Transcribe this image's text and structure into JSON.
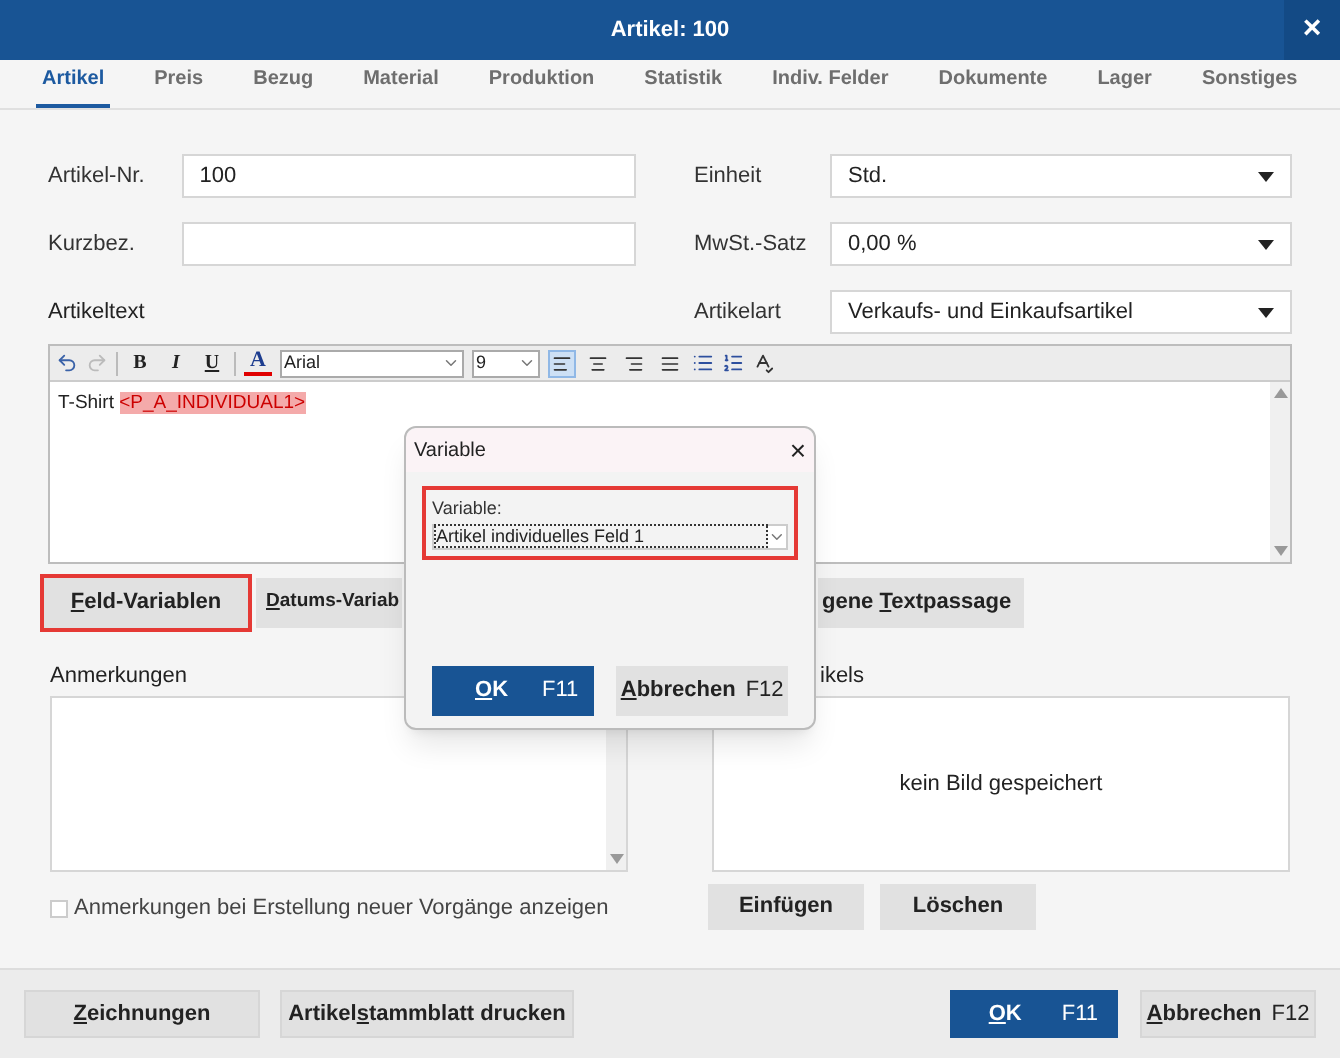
{
  "window": {
    "title": "Artikel: 100",
    "close": "×"
  },
  "tabs": [
    {
      "label": "Artikel",
      "selected": true
    },
    {
      "label": "Preis",
      "selected": false
    },
    {
      "label": "Bezug",
      "selected": false
    },
    {
      "label": "Material",
      "selected": false
    },
    {
      "label": "Produktion",
      "selected": false
    },
    {
      "label": "Statistik",
      "selected": false
    },
    {
      "label": "Indiv. Felder",
      "selected": false
    },
    {
      "label": "Dokumente",
      "selected": false
    },
    {
      "label": "Lager",
      "selected": false
    },
    {
      "label": "Sonstiges",
      "selected": false
    }
  ],
  "left_fields": [
    {
      "label": "Artikel-Nr.",
      "value": "100"
    },
    {
      "label": "Kurzbez."
    }
  ],
  "right_fields": [
    {
      "label": "Einheit",
      "value": "Std."
    },
    {
      "label": "MwSt.-Satz",
      "value": "0,00 %"
    },
    {
      "label": "Artikelart",
      "value": "Verkaufs- und Einkaufsartikel"
    }
  ],
  "artikeltext": {
    "label": "Artikeltext",
    "toolbar": {
      "undo_disabled": false,
      "redo_disabled": true,
      "format_buttons": [
        "B",
        "I",
        "U"
      ],
      "font_color": "A",
      "font": "Arial",
      "size": "9",
      "alignments": [
        {
          "selected": true
        },
        {
          "selected": false
        },
        {
          "selected": false
        },
        {
          "selected": false
        }
      ]
    },
    "text": "T-Shirt",
    "variable": "<P_A_INDIVIDUAL1>"
  },
  "text_buttons": [
    {
      "key": "F",
      "post": "eld-Variablen",
      "highlighted": true
    },
    {
      "key": "D",
      "post": "atums-Variab",
      "highlighted": false
    },
    {
      "pre": "gene ",
      "key": "T",
      "post": "extpassage",
      "highlighted": false
    }
  ],
  "anmerkungen": {
    "label": "Anmerkungen",
    "checkbox": {
      "label": "Anmerkungen bei Erstellung neuer Vorgänge anzeigen",
      "checked": false
    }
  },
  "bild": {
    "label": "ikels",
    "empty_text": "kein Bild gespeichert",
    "buttons": [
      "Einfügen",
      "Löschen"
    ]
  },
  "footer": {
    "left_buttons": [
      {
        "key": "Z",
        "post": "eichnungen"
      },
      {
        "pre": "Artikel",
        "key": "s",
        "post": "tammblatt drucken"
      }
    ],
    "ok": {
      "key": "O",
      "post": "K",
      "shortcut": "F11"
    },
    "cancel": {
      "key": "A",
      "post": "bbrechen",
      "shortcut": "F12"
    }
  },
  "dialog": {
    "title": "Variable",
    "close": "×",
    "field_label": "Variable:",
    "value": "Artikel individuelles Feld 1",
    "highlighted": true,
    "ok": {
      "key": "O",
      "post": "K",
      "shortcut": "F11"
    },
    "cancel": {
      "key": "A",
      "post": "bbrechen",
      "shortcut": "F12"
    }
  }
}
